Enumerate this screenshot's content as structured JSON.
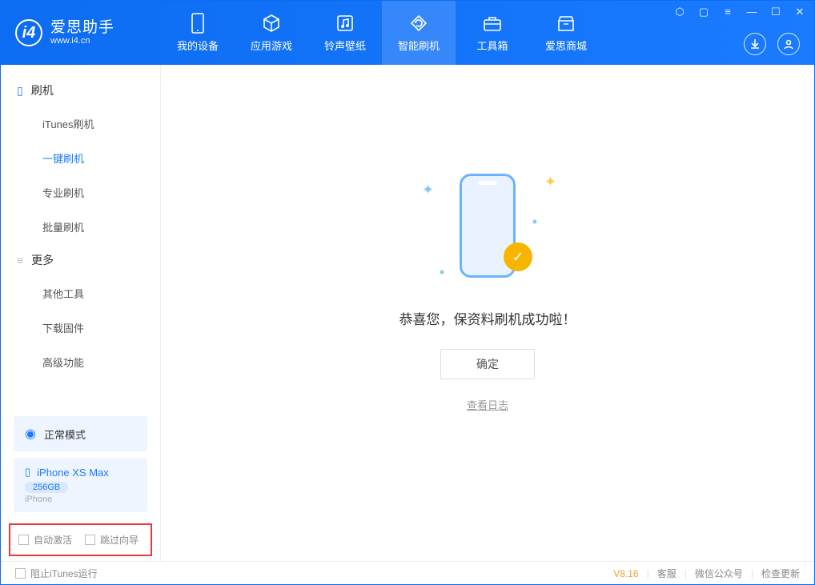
{
  "app": {
    "name": "爱思助手",
    "url": "www.i4.cn"
  },
  "nav": [
    {
      "label": "我的设备"
    },
    {
      "label": "应用游戏"
    },
    {
      "label": "铃声壁纸"
    },
    {
      "label": "智能刷机",
      "active": true
    },
    {
      "label": "工具箱"
    },
    {
      "label": "爱思商城"
    }
  ],
  "sidebar": {
    "group1_title": "刷机",
    "group1_items": [
      "iTunes刷机",
      "一键刷机",
      "专业刷机",
      "批量刷机"
    ],
    "group2_title": "更多",
    "group2_items": [
      "其他工具",
      "下载固件",
      "高级功能"
    ],
    "mode_label": "正常模式",
    "device": {
      "name": "iPhone XS Max",
      "capacity": "256GB",
      "type": "iPhone"
    },
    "checkbox_row": {
      "c1": "自动激活",
      "c2": "跳过向导"
    }
  },
  "main": {
    "congrats": "恭喜您，保资料刷机成功啦！",
    "ok_button": "确定",
    "log_link": "查看日志"
  },
  "status": {
    "block_itunes": "阻止iTunes运行",
    "version": "V8.16",
    "links": [
      "客服",
      "微信公众号",
      "检查更新"
    ]
  }
}
